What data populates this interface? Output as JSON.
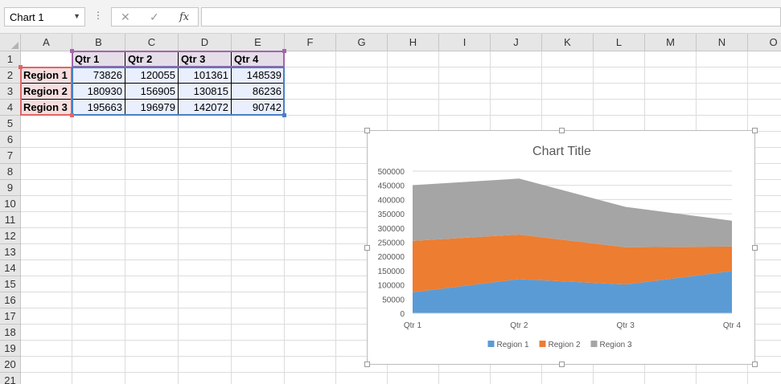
{
  "formula_bar": {
    "name_box": "Chart 1",
    "formula": "",
    "cancel_icon": "✕",
    "enter_icon": "✓",
    "fx_label": "fx"
  },
  "columns": [
    "A",
    "B",
    "C",
    "D",
    "E",
    "F",
    "G",
    "H",
    "I",
    "J",
    "K",
    "L",
    "M",
    "N",
    "O"
  ],
  "rows": [
    "1",
    "2",
    "3",
    "4",
    "5",
    "6",
    "7",
    "8",
    "9",
    "10",
    "11",
    "12",
    "13",
    "14",
    "15",
    "16",
    "17",
    "18",
    "19",
    "20",
    "21"
  ],
  "sheet": {
    "headers": [
      "Qtr 1",
      "Qtr 2",
      "Qtr 3",
      "Qtr 4"
    ],
    "regions": [
      {
        "label": "Region 1",
        "values": [
          "73826",
          "120055",
          "101361",
          "148539"
        ]
      },
      {
        "label": "Region 2",
        "values": [
          "180930",
          "156905",
          "130815",
          "86236"
        ]
      },
      {
        "label": "Region 3",
        "values": [
          "195663",
          "196979",
          "142072",
          "90742"
        ]
      }
    ]
  },
  "chart_data": {
    "type": "area",
    "stacked": true,
    "title": "Chart Title",
    "categories": [
      "Qtr 1",
      "Qtr 2",
      "Qtr 3",
      "Qtr 4"
    ],
    "series": [
      {
        "name": "Region 1",
        "values": [
          73826,
          120055,
          101361,
          148539
        ],
        "color": "#5b9bd5"
      },
      {
        "name": "Region 2",
        "values": [
          180930,
          156905,
          130815,
          86236
        ],
        "color": "#ed7d31"
      },
      {
        "name": "Region 3",
        "values": [
          195663,
          196979,
          142072,
          90742
        ],
        "color": "#a5a5a5"
      }
    ],
    "y_ticks": [
      "0",
      "50000",
      "100000",
      "150000",
      "200000",
      "250000",
      "300000",
      "350000",
      "400000",
      "450000",
      "500000"
    ],
    "ylim": [
      0,
      500000
    ],
    "grid": true,
    "legend": "bottom"
  }
}
